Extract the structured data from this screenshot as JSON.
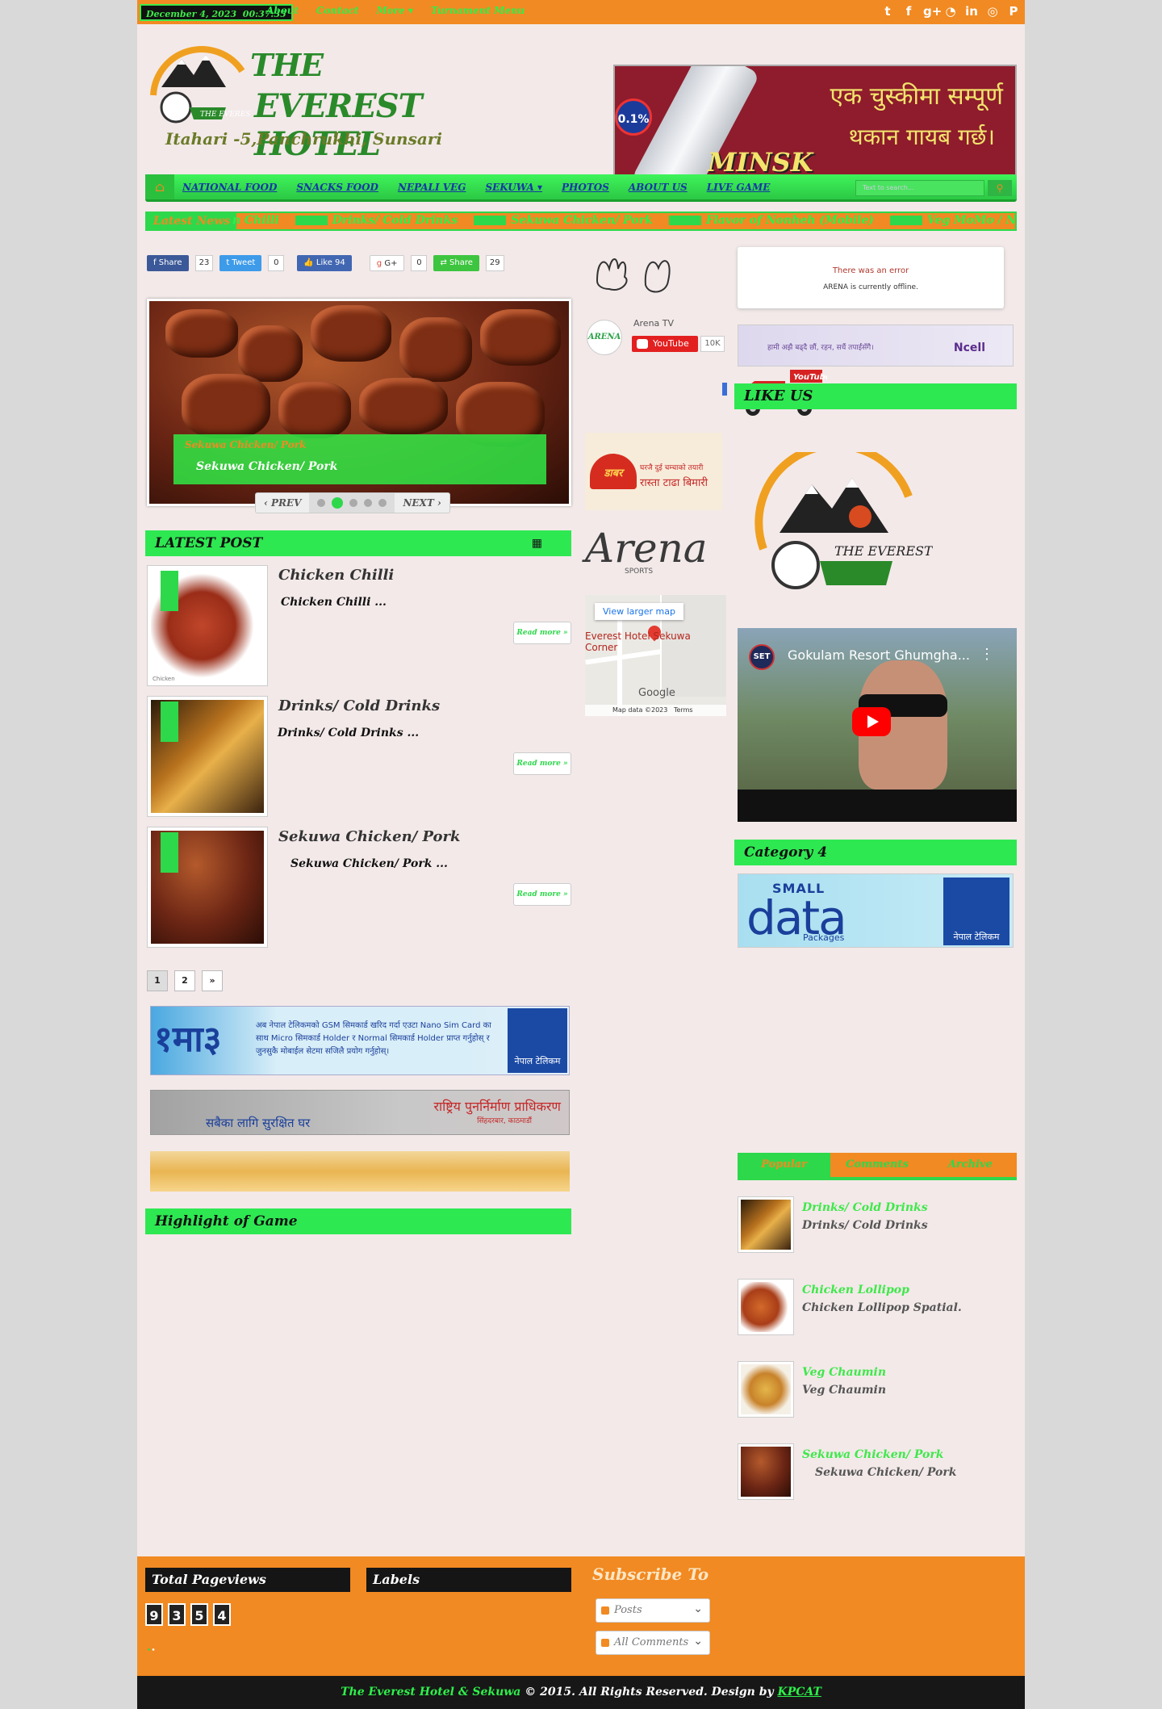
{
  "topbar": {
    "date": "December 4, 2023",
    "time": "00:37:35",
    "links": [
      "About",
      "Contact",
      "More",
      "Turnament Menu"
    ],
    "social_icons": [
      "twitter-icon",
      "facebook-icon",
      "google-plus-icon",
      "rss-icon",
      "linkedin-icon",
      "dribbble-icon",
      "pinterest-icon"
    ]
  },
  "header": {
    "title_line1": "THE",
    "title_line2": "EVEREST HOTEL",
    "subtitle": "Itahari -5,Panchrukhi, Sunsari",
    "logo_small": "THE EVEREST"
  },
  "banner_ad": {
    "line1": "एक चुस्कीमा सम्पूर्ण",
    "line2": "थकान गायब गर्छ।",
    "brand": "MINSK",
    "badge": "0.1%"
  },
  "nav": {
    "items": [
      "NATIONAL FOOD",
      "SNACKS FOOD",
      "NEPALI VEG",
      "SEKUWA",
      "PHOTOS",
      "ABOUT US",
      "LIVE GAME"
    ],
    "search_placeholder": "Text to search..."
  },
  "ticker": {
    "label": "Latest News",
    "items": [
      "n Chilli",
      "Drinks/ Cold Drinks",
      "Sekuwa Chicken/ Pork",
      "Flavor of Nonheh (Mobile)",
      "Veg MoMo / Non Veg MoMo"
    ]
  },
  "share": {
    "facebook": {
      "label": "Share",
      "count": "23"
    },
    "twitter": {
      "label": "Tweet",
      "count": "0"
    },
    "like": {
      "label": "Like",
      "count": "94"
    },
    "gplus": {
      "label": "G+",
      "count": "0"
    },
    "share": {
      "label": "Share",
      "count": "29"
    }
  },
  "slider": {
    "category": "Sekuwa Chicken/ Pork",
    "caption": "Sekuwa Chicken/ Pork",
    "prev": "PREV",
    "next": "NEXT"
  },
  "latest": {
    "heading": "LATEST POST",
    "posts": [
      {
        "title": "Chicken Chilli",
        "excerpt": "Chicken Chilli ...",
        "read_more": "Read more »",
        "caption": "Chicken"
      },
      {
        "title": "Drinks/ Cold Drinks",
        "excerpt": "Drinks/ Cold Drinks ...",
        "read_more": "Read more »"
      },
      {
        "title": "Sekuwa Chicken/ Pork",
        "excerpt": "Sekuwa Chicken/ Pork ...",
        "read_more": "Read more »"
      }
    ]
  },
  "pager": [
    "1",
    "2",
    "»"
  ],
  "ads": {
    "nt_big": "१मा३",
    "nt_text": "अब नेपाल टेलिकमको GSM सिमकार्ड खरिद गर्दा एउटा Nano Sim Card का साथ Micro सिमकार्ड Holder र Normal सिमकार्ड Holder प्राप्त गर्नुहोस् र जुनसुकै मोबाईल सेटमा सजिलै प्रयोग गर्नुहोस्।",
    "nt_logo": "नेपाल टेलिकम",
    "rec_a": "सबैका लागि सुरक्षित घर",
    "rec_b": "राष्ट्रिय पुनर्निर्माण प्राधिकरण",
    "rec_c": "सिंहदरबार, काठमाडौं"
  },
  "highlight": {
    "heading": "Highlight of Game"
  },
  "mid": {
    "tv_name": "Arena TV",
    "tv_logo": "ARENA",
    "yt_label": "YouTube",
    "yt_count": "10K",
    "truck_label": "YouTube",
    "dabur_logo": "डाबर",
    "dabur_line1": "घरजै दुई चम्चाको तयारी",
    "dabur_line2": "रास्ता टाढा बिमारी",
    "arena_text": "Arena",
    "arena_sub": "SPORTS",
    "map_link": "View larger map",
    "map_place": "Everest Hotel Sekuwa Corner",
    "map_brand": "Google",
    "map_data": "Map data ©2023",
    "map_terms": "Terms"
  },
  "right": {
    "error_title": "There was an error",
    "error_msg": "ARENA is currently offline.",
    "ncell_text": "हामी अझै बढ्दै छौं, रहन, सधैं तपाईंसँगै।",
    "ncell_brand": "Ncell",
    "likeus": "LIKE US",
    "video_title": "Gokulam Resort Ghumgha...",
    "video_channel": "SET",
    "category_heading": "Category 4",
    "sd_small": "SMALL",
    "sd_data": "data",
    "sd_packages": "Packages",
    "sd_logo": "नेपाल टेलिकम",
    "tabs": [
      "Popular",
      "Comments",
      "Archive"
    ],
    "popular": [
      {
        "title": "Drinks/ Cold Drinks",
        "sub": "Drinks/ Cold Drinks"
      },
      {
        "title": "Chicken Lollipop",
        "sub": "Chicken Lollipop Spatial."
      },
      {
        "title": "Veg Chaumin",
        "sub": "Veg Chaumin"
      },
      {
        "title": "Sekuwa Chicken/ Pork",
        "sub": "Sekuwa Chicken/ Pork"
      }
    ]
  },
  "footer": {
    "pageviews_heading": "Total Pageviews",
    "pageviews_digits": [
      "9",
      "3",
      "5",
      "4"
    ],
    "labels_heading": "Labels",
    "subscribe_heading": "Subscribe To",
    "sub_posts": "Posts",
    "sub_comments": "All Comments",
    "copyright_name": "The Everest Hotel & Sekuwa",
    "copyright_rest": "© 2015. All Rights Reserved. Design by",
    "designer": "KPCAT"
  },
  "colors": {
    "orange": "#f18a22",
    "green": "#2ed84b",
    "nav_text": "#1538a4",
    "footer_dark": "#171717"
  }
}
